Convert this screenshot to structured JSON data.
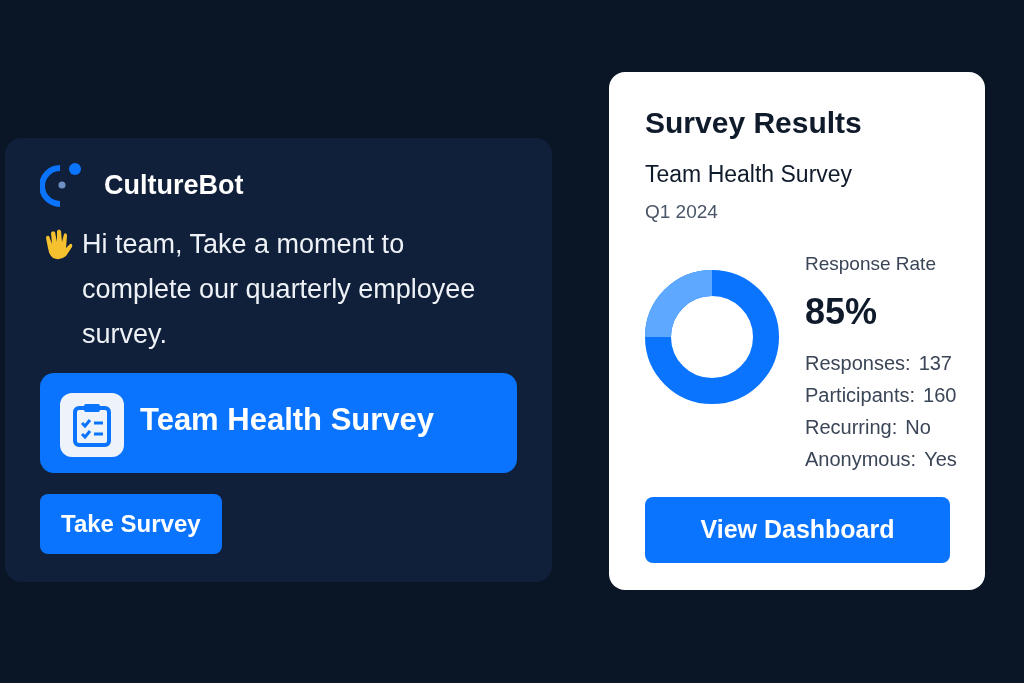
{
  "bot": {
    "name": "CultureBot",
    "message": "Hi team, Take a moment to complete our quarterly employee survey.",
    "survey_title": "Team Health Survey",
    "action": "Take Survey"
  },
  "results": {
    "title": "Survey Results",
    "survey_name": "Team Health Survey",
    "period": "Q1 2024",
    "rate_label": "Response Rate",
    "rate": "85%",
    "stats": [
      {
        "label": "Responses:",
        "value": "137"
      },
      {
        "label": "Participants:",
        "value": "160"
      },
      {
        "label": "Recurring:",
        "value": "No"
      },
      {
        "label": "Anonymous:",
        "value": "Yes"
      }
    ],
    "button": "View Dashboard"
  }
}
